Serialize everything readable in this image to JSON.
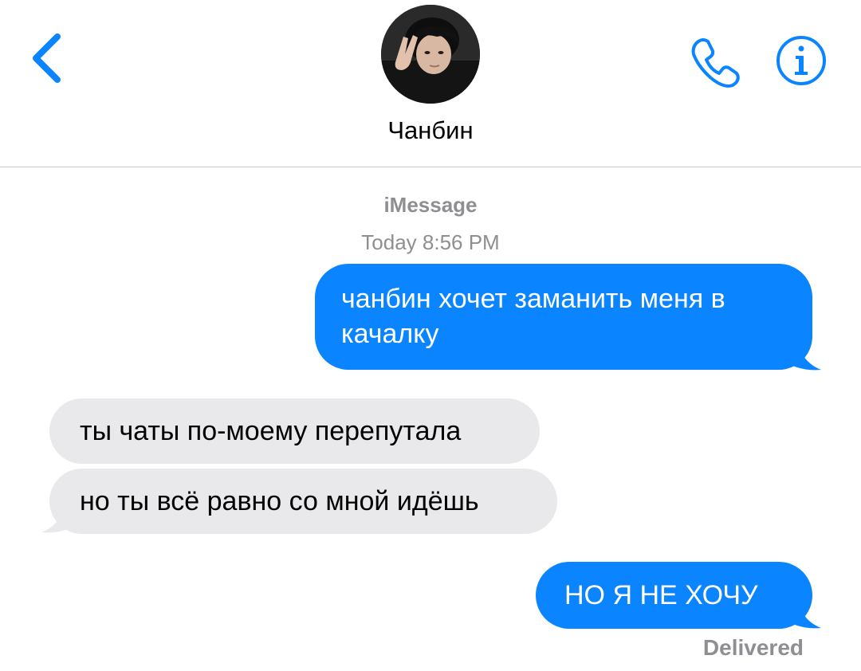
{
  "header": {
    "contact_name": "Чанбин",
    "back_icon": "chevron-left-icon",
    "call_icon": "phone-icon",
    "info_icon": "info-icon",
    "avatar": "contact-avatar"
  },
  "conversation": {
    "service_label": "iMessage",
    "timestamp": "Today 8:56 PM",
    "messages": [
      {
        "direction": "sent",
        "lines": [
          "чанбин хочет заманить меня в",
          "качалку"
        ]
      },
      {
        "direction": "received",
        "text": "ты чаты по-моему перепутала"
      },
      {
        "direction": "received",
        "text": "но ты всё равно со мной идёшь"
      },
      {
        "direction": "sent",
        "text": "НО Я НЕ ХОЧУ"
      }
    ],
    "status": "Delivered"
  },
  "colors": {
    "accent": "#0b84ff",
    "sent_bubble": "#0b84ff",
    "received_bubble": "#e9e9eb",
    "secondary_text": "#8e8e93",
    "divider": "#c8c7cc"
  }
}
